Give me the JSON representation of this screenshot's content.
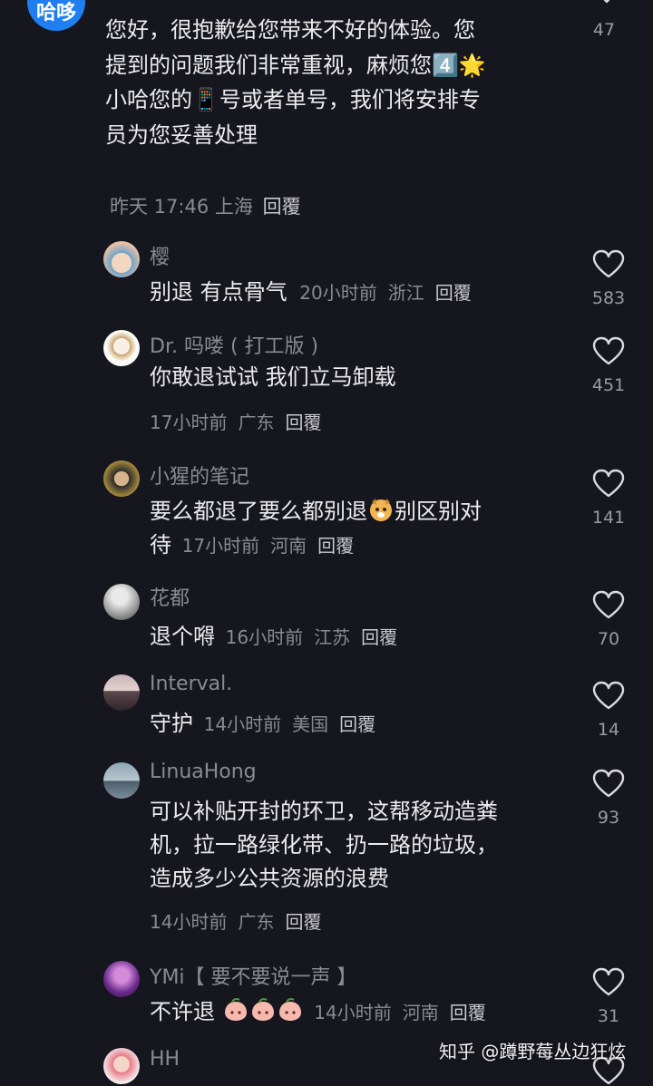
{
  "top_comment": {
    "avatar_text": "哈哆",
    "lines": [
      "您好，很抱歉给您带来不好的体验。您",
      "提到的问题我们非常重视，麻烦您4️⃣🌟",
      "小哈您的📱号或者单号，我们将安排专",
      "员为您妥善处理"
    ],
    "time": "昨天 17:46",
    "region": "上海",
    "reply_label": "回覆",
    "likes": "47"
  },
  "replies": [
    {
      "name": "樱",
      "text": "别退 有点骨气",
      "time": "20小时前",
      "region": "浙江",
      "reply_label": "回覆",
      "likes": "583"
    },
    {
      "name": "Dr. 吗喽 ( 打工版 )",
      "text": "你敢退试试 我们立马卸载",
      "time": "17小时前",
      "region": "广东",
      "reply_label": "回覆",
      "likes": "451"
    },
    {
      "name": "小猩的笔记",
      "text_a": "要么都退了要么都别退",
      "text_b": "别区别对",
      "text_c": "待",
      "time": "17小时前",
      "region": "河南",
      "reply_label": "回覆",
      "likes": "141"
    },
    {
      "name": "花都",
      "text": "退个嘚",
      "time": "16小时前",
      "region": "江苏",
      "reply_label": "回覆",
      "likes": "70"
    },
    {
      "name": "Interval.",
      "text": "守护",
      "time": "14小时前",
      "region": "美国",
      "reply_label": "回覆",
      "likes": "14"
    },
    {
      "name": "LinuaHong",
      "lines": [
        "可以补贴开封的环卫，这帮移动造粪",
        "机，拉一路绿化带、扔一路的垃圾，",
        "造成多少公共资源的浪费"
      ],
      "time": "14小时前",
      "region": "广东",
      "reply_label": "回覆",
      "likes": "93"
    },
    {
      "name": "YMi【 要不要说一声 】",
      "text": "不许退",
      "time": "14小时前",
      "region": "河南",
      "reply_label": "回覆",
      "likes": "31"
    },
    {
      "name": "HH"
    }
  ],
  "watermark": "知乎 @蹲野莓丛边狂炫",
  "colors": {
    "background": "#16161e",
    "avatar_blue": "#1f7ff0",
    "muted": "#8a8a93",
    "text": "#ececef"
  }
}
